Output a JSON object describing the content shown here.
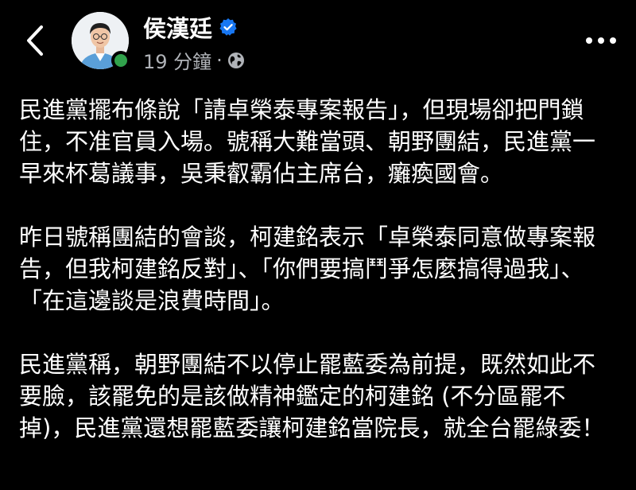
{
  "header": {
    "author_name": "侯漢廷",
    "timestamp": "19 分鐘",
    "separator": "·",
    "verified_icon": "verified-badge-icon",
    "privacy_icon": "globe-icon",
    "back_icon": "chevron-left-icon",
    "more_icon": "more-options-icon"
  },
  "post": {
    "paragraphs": [
      "民進黨擺布條說「請卓榮泰專案報告」，但現場卻把門鎖住，不准官員入場。號稱大難當頭、朝野團結，民進黨一早來杯葛議事，吳秉叡霸佔主席台，癱瘓國會。",
      "昨日號稱團結的會談，柯建銘表示「卓榮泰同意做專案報告，但我柯建銘反對」、「你們要搞鬥爭怎麼搞得過我」、「在這邊談是浪費時間」。",
      "民進黨稱，朝野團結不以停止罷藍委為前提，既然如此不要臉，該罷免的是該做精神鑑定的柯建銘 (不分區罷不掉)，民進黨還想罷藍委讓柯建銘當院長，就全台罷綠委！"
    ]
  },
  "colors": {
    "background": "#000000",
    "text": "#ffffff",
    "secondary_text": "#b0b3b8",
    "verified_blue": "#1877f2",
    "online_green": "#31a24c"
  }
}
